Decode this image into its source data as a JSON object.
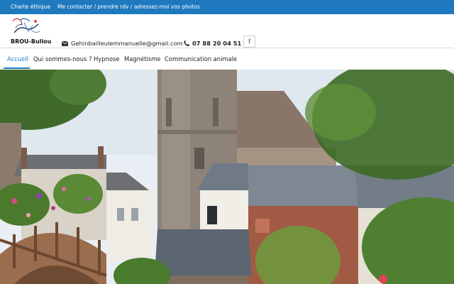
{
  "topbar": {
    "links": [
      "Charte éthique",
      "Me contacter / prendre rdv / adressez-moi vos photos"
    ]
  },
  "header": {
    "brand": "BROU-Bullou",
    "email": "Gehinbailleulemmanuelle@gmail.com",
    "phone": "07 88 20 04 51",
    "social_label": "f"
  },
  "nav": {
    "items": [
      "Accueil",
      "Qui sommes-nous ?",
      "Hypnose",
      "Magnétisme",
      "Communication animale"
    ],
    "active_index": 0
  },
  "colors": {
    "accent": "#1e79be",
    "topbar_bg": "#1e79be"
  },
  "icons": {
    "email": "envelope-icon",
    "phone": "phone-icon",
    "social": "facebook-icon"
  }
}
